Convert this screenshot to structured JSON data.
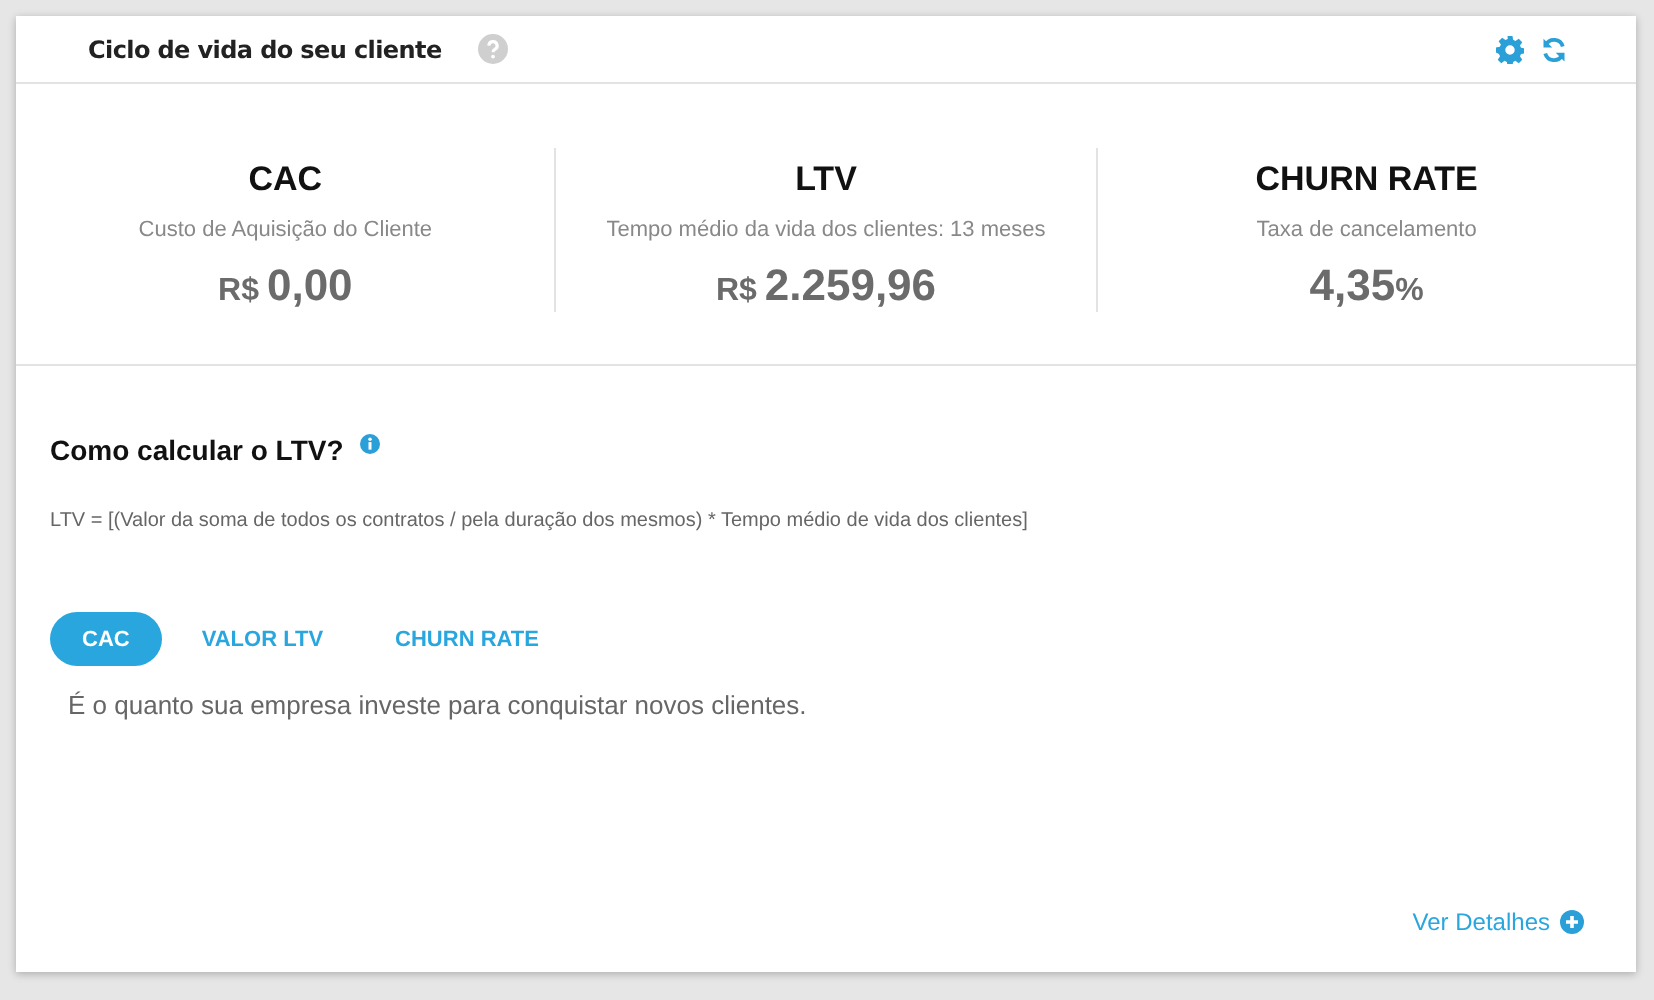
{
  "header": {
    "title": "Ciclo de vida do seu cliente"
  },
  "metrics": [
    {
      "label": "CAC",
      "subtitle": "Custo de Aquisição do Cliente",
      "prefix": "R$",
      "value": "0,00"
    },
    {
      "label": "LTV",
      "subtitle": "Tempo médio da vida dos clientes: 13 meses",
      "prefix": "R$",
      "value": "2.259,96"
    },
    {
      "label": "CHURN RATE",
      "subtitle": "Taxa de cancelamento",
      "value": "4,35",
      "suffix": "%"
    }
  ],
  "section": {
    "title": "Como calcular o LTV?",
    "formula": "LTV = [(Valor da soma de todos os contratos / pela duração dos mesmos) * Tempo médio de vida dos clientes]"
  },
  "tabs": [
    {
      "label": "CAC",
      "selected": true
    },
    {
      "label": "VALOR LTV",
      "selected": false
    },
    {
      "label": "CHURN RATE",
      "selected": false
    }
  ],
  "description": "É o quanto sua empresa investe para conquistar novos clientes.",
  "footer_link": "Ver Detalhes"
}
